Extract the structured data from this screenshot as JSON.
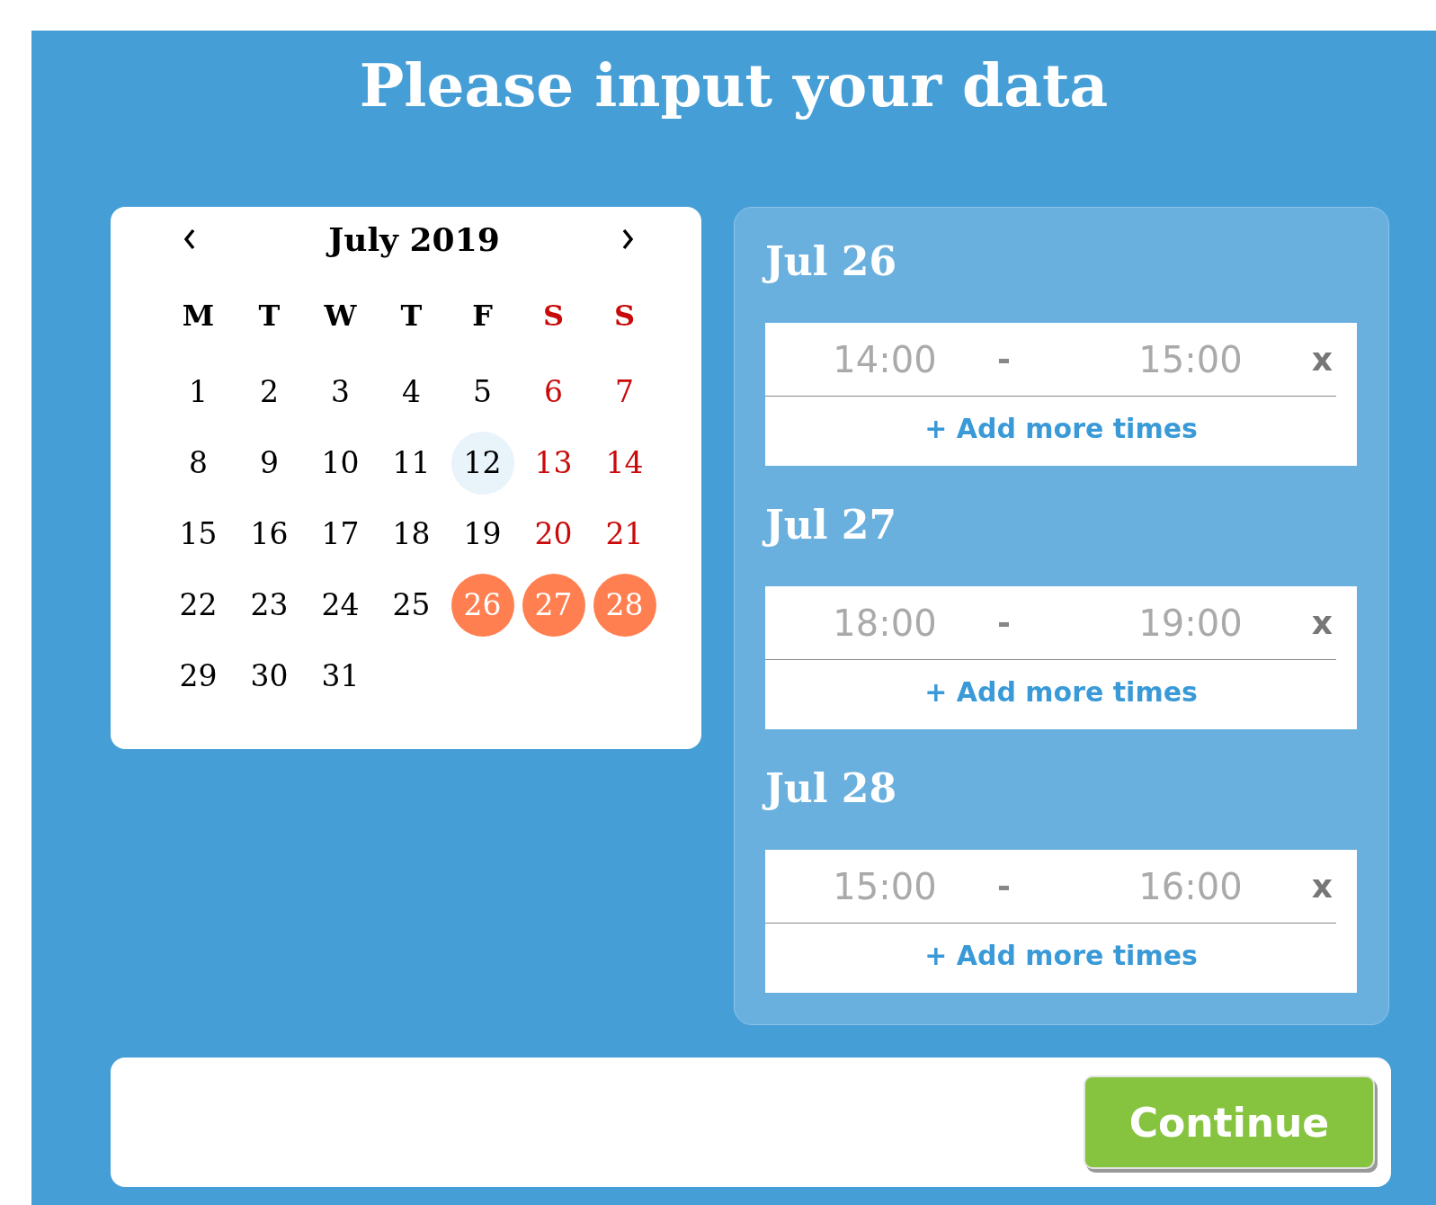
{
  "title": "Please input your data",
  "calendar": {
    "month_label": "July 2019",
    "weekdays": [
      {
        "label": "M",
        "weekend": false
      },
      {
        "label": "T",
        "weekend": false
      },
      {
        "label": "W",
        "weekend": false
      },
      {
        "label": "T",
        "weekend": false
      },
      {
        "label": "F",
        "weekend": false
      },
      {
        "label": "S",
        "weekend": true
      },
      {
        "label": "S",
        "weekend": true
      }
    ],
    "days": [
      {
        "label": "1",
        "weekend": false,
        "today": false,
        "selected": false
      },
      {
        "label": "2",
        "weekend": false,
        "today": false,
        "selected": false
      },
      {
        "label": "3",
        "weekend": false,
        "today": false,
        "selected": false
      },
      {
        "label": "4",
        "weekend": false,
        "today": false,
        "selected": false
      },
      {
        "label": "5",
        "weekend": false,
        "today": false,
        "selected": false
      },
      {
        "label": "6",
        "weekend": true,
        "today": false,
        "selected": false
      },
      {
        "label": "7",
        "weekend": true,
        "today": false,
        "selected": false
      },
      {
        "label": "8",
        "weekend": false,
        "today": false,
        "selected": false
      },
      {
        "label": "9",
        "weekend": false,
        "today": false,
        "selected": false
      },
      {
        "label": "10",
        "weekend": false,
        "today": false,
        "selected": false
      },
      {
        "label": "11",
        "weekend": false,
        "today": false,
        "selected": false
      },
      {
        "label": "12",
        "weekend": false,
        "today": true,
        "selected": false
      },
      {
        "label": "13",
        "weekend": true,
        "today": false,
        "selected": false
      },
      {
        "label": "14",
        "weekend": true,
        "today": false,
        "selected": false
      },
      {
        "label": "15",
        "weekend": false,
        "today": false,
        "selected": false
      },
      {
        "label": "16",
        "weekend": false,
        "today": false,
        "selected": false
      },
      {
        "label": "17",
        "weekend": false,
        "today": false,
        "selected": false
      },
      {
        "label": "18",
        "weekend": false,
        "today": false,
        "selected": false
      },
      {
        "label": "19",
        "weekend": false,
        "today": false,
        "selected": false
      },
      {
        "label": "20",
        "weekend": true,
        "today": false,
        "selected": false
      },
      {
        "label": "21",
        "weekend": true,
        "today": false,
        "selected": false
      },
      {
        "label": "22",
        "weekend": false,
        "today": false,
        "selected": false
      },
      {
        "label": "23",
        "weekend": false,
        "today": false,
        "selected": false
      },
      {
        "label": "24",
        "weekend": false,
        "today": false,
        "selected": false
      },
      {
        "label": "25",
        "weekend": false,
        "today": false,
        "selected": false
      },
      {
        "label": "26",
        "weekend": false,
        "today": false,
        "selected": true
      },
      {
        "label": "27",
        "weekend": true,
        "today": false,
        "selected": true
      },
      {
        "label": "28",
        "weekend": true,
        "today": false,
        "selected": true
      },
      {
        "label": "29",
        "weekend": false,
        "today": false,
        "selected": false
      },
      {
        "label": "30",
        "weekend": false,
        "today": false,
        "selected": false
      },
      {
        "label": "31",
        "weekend": false,
        "today": false,
        "selected": false
      }
    ]
  },
  "time_entries": [
    {
      "date": "Jul 26",
      "start": "14:00",
      "separator": "-",
      "end": "15:00",
      "remove": "x",
      "add_link": "+ Add more times"
    },
    {
      "date": "Jul 27",
      "start": "18:00",
      "separator": "-",
      "end": "19:00",
      "remove": "x",
      "add_link": "+ Add more times"
    },
    {
      "date": "Jul 28",
      "start": "15:00",
      "separator": "-",
      "end": "16:00",
      "remove": "x",
      "add_link": "+ Add more times"
    }
  ],
  "continue_button": "Continue"
}
